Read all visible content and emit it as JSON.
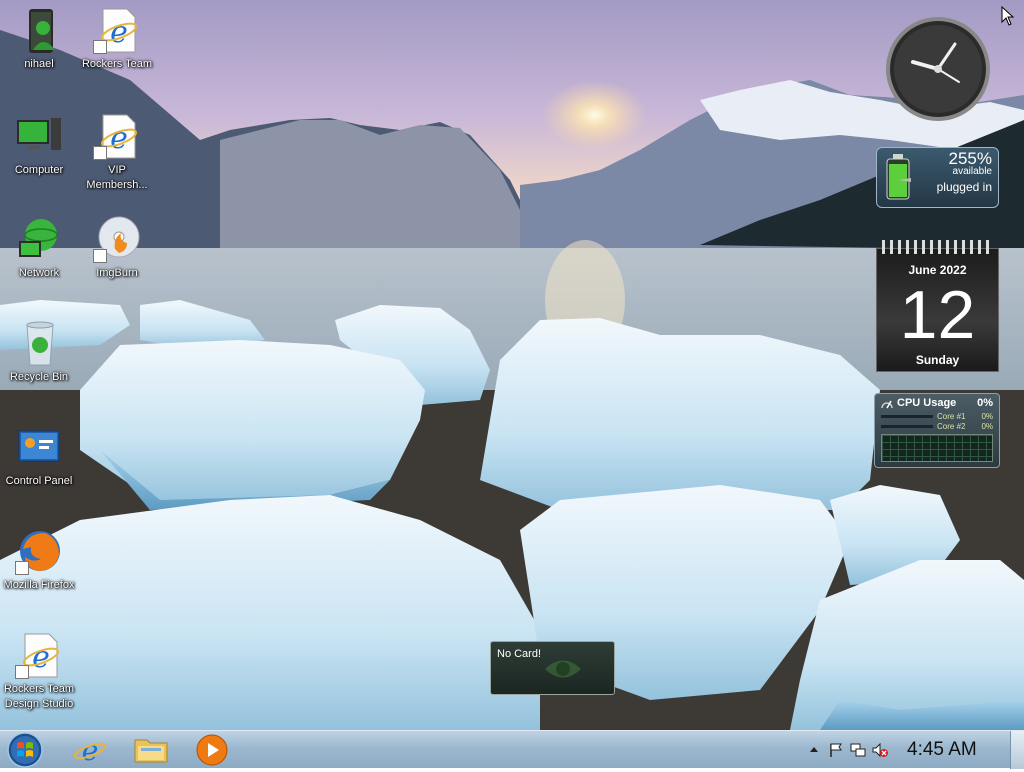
{
  "desktop": {
    "icons": [
      {
        "id": "nihael",
        "label": "nihael",
        "icon": "user-folder-icon"
      },
      {
        "id": "rockers-team",
        "label": "Rockers Team",
        "icon": "internet-explorer-icon"
      },
      {
        "id": "computer",
        "label": "Computer",
        "icon": "computer-icon"
      },
      {
        "id": "vip-membership",
        "label": "VIP Membersh...",
        "icon": "internet-explorer-icon"
      },
      {
        "id": "network",
        "label": "Network",
        "icon": "network-icon"
      },
      {
        "id": "imgburn",
        "label": "ImgBurn",
        "icon": "disc-burn-icon"
      },
      {
        "id": "recycle-bin",
        "label": "Recycle Bin",
        "icon": "recycle-bin-icon"
      },
      {
        "id": "control-panel",
        "label": "Control Panel",
        "icon": "control-panel-icon"
      },
      {
        "id": "firefox",
        "label": "Mozilla Firefox",
        "icon": "firefox-icon"
      },
      {
        "id": "rockers-team-design",
        "label": "Rockers Team Design Studio",
        "icon": "internet-explorer-icon"
      }
    ]
  },
  "gadgets": {
    "battery": {
      "percent": "255%",
      "status": "available",
      "power": "plugged in"
    },
    "calendar": {
      "month": "June 2022",
      "day": "12",
      "weekday": "Sunday"
    },
    "cpu": {
      "title": "CPU Usage",
      "total": "0%",
      "cores": [
        {
          "name": "Core #1",
          "value": "0%"
        },
        {
          "name": "Core #2",
          "value": "0%"
        }
      ]
    },
    "notice": {
      "text": "No Card!"
    }
  },
  "taskbar": {
    "pinned": [
      {
        "name": "internet-explorer",
        "icon": "internet-explorer-icon"
      },
      {
        "name": "windows-explorer",
        "icon": "folder-icon"
      },
      {
        "name": "media-player",
        "icon": "media-player-icon"
      }
    ],
    "tray": {
      "icons": [
        "expand-tray-icon",
        "flag-icon",
        "network-status-icon",
        "volume-muted-icon"
      ],
      "time": "4:45 AM"
    }
  },
  "colors": {
    "taskbar": "#9cb8cf",
    "ie_blue": "#1e6fd0",
    "battery_green": "#5ccf3c"
  }
}
